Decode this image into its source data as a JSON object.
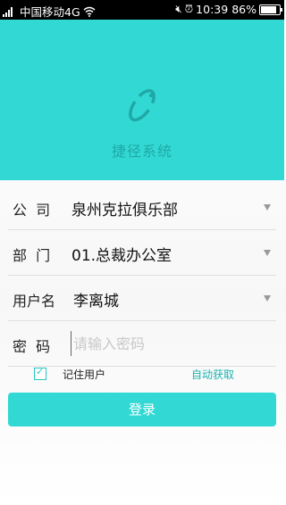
{
  "status_bar": {
    "carrier": "中国移动4G",
    "time": "10:39",
    "battery": "86%",
    "icons": [
      "signal-icon",
      "wifi-icon",
      "mute-icon",
      "alarm-icon",
      "battery-icon"
    ]
  },
  "header": {
    "app_title": "捷径系统",
    "accent_color": "#32d9d4"
  },
  "form": {
    "company": {
      "label": "公  司",
      "value": "泉州克拉俱乐部"
    },
    "department": {
      "label": "部  门",
      "value": "01.总裁办公室"
    },
    "username": {
      "label": "用户名",
      "value": "李离城"
    },
    "password": {
      "label": "密  码",
      "placeholder": "请输入密码",
      "value": ""
    },
    "remember_label": "记住用户",
    "remember_checked": true,
    "auto_fetch": "自动获取",
    "login_button": "登录"
  }
}
